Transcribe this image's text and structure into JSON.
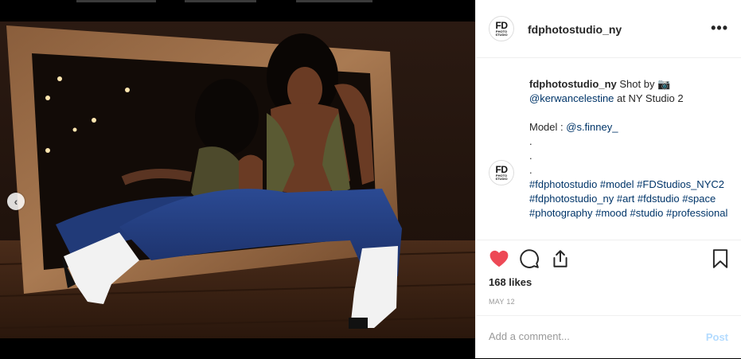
{
  "post": {
    "username": "fdphotostudio_ny",
    "avatar": {
      "line1": "FD",
      "line2": "PHOTO",
      "line3": "STUDIO"
    },
    "more_icon": "more-horizontal-icon",
    "caption": {
      "user": "fdphotostudio_ny",
      "text_1": " Shot by ",
      "glyph": "📷",
      "mention_1": "@kerwancelestine",
      "text_2": " at NY Studio 2",
      "model_label": "Model : ",
      "mention_2": "@s.finney_",
      "dots": [
        ".",
        ".",
        "."
      ],
      "hashtags": "#fdphotostudio #model #FDStudios_NYC2 #fdphotostudio_ny #art #fdstudio #space #photography #mood #studio #professional"
    },
    "actions": {
      "like_icon": "heart-filled-icon",
      "comment_icon": "comment-icon",
      "share_icon": "share-icon",
      "save_icon": "bookmark-icon"
    },
    "likes": "168 likes",
    "date": "MAY 12",
    "comment": {
      "placeholder": "Add a comment...",
      "post_label": "Post"
    },
    "carousel": {
      "prev_label": "‹",
      "dots": 2,
      "active_dot": 2
    },
    "colors": {
      "like": "#ed4956",
      "link": "#003569",
      "post_disabled": "#b3dbff"
    }
  }
}
